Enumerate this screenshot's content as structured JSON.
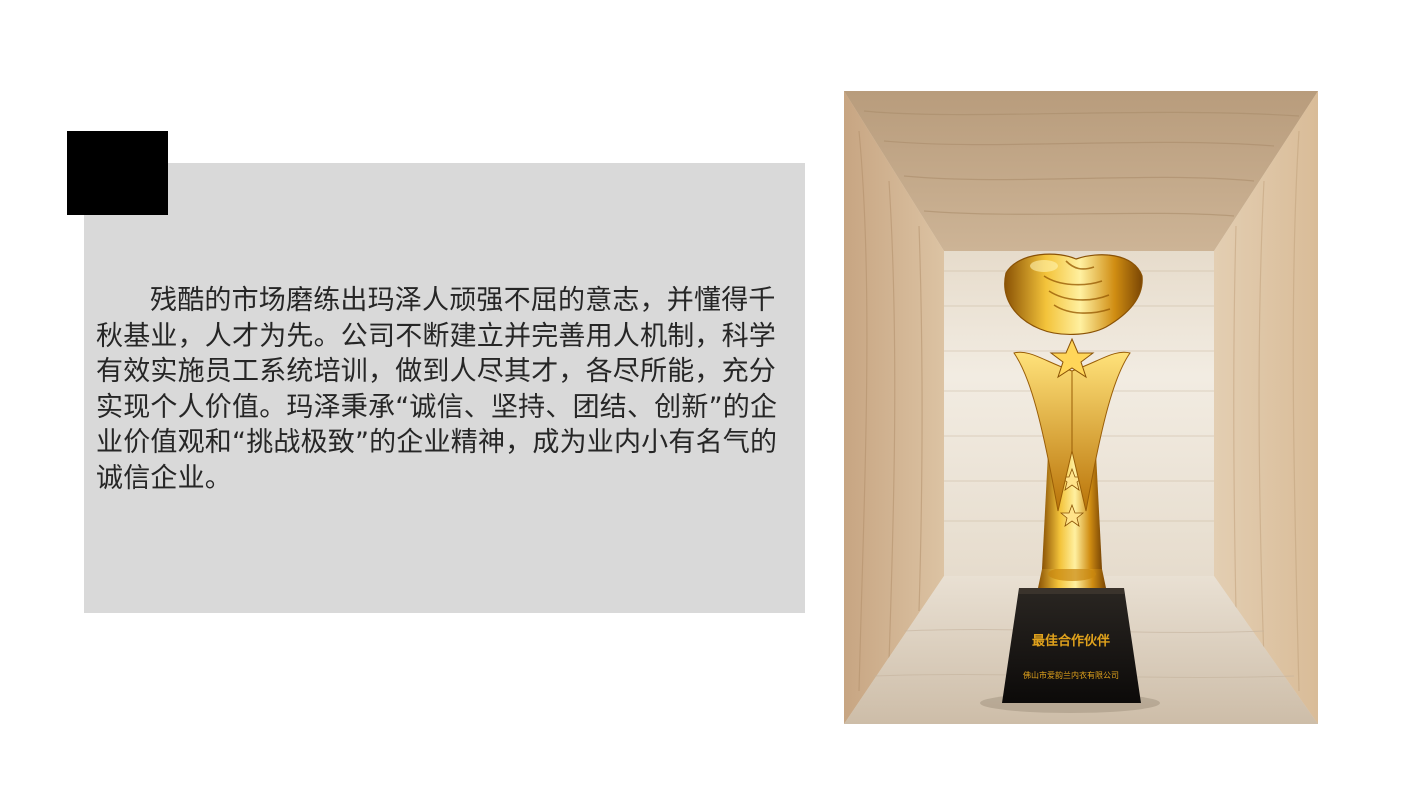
{
  "paragraph": "残酷的市场磨练出玛泽人顽强不屈的意志，并懂得千秋基业，人才为先。公司不断建立并完善用人机制，科学有效实施员工系统培训，做到人尽其才，各尽所能，充分实现个人价值。玛泽秉承“诚信、坚持、团结、创新”的企业价值观和“挑战极致”的企业精神，成为业内小有名气的诚信企业。",
  "trophy": {
    "award_title": "最佳合作伙伴",
    "recipient": "佛山市爱韵兰内衣有限公司"
  },
  "colors": {
    "panel": "#d9d9d9",
    "corner_block": "#000000",
    "text": "#262626",
    "gold": "#e0a21c"
  }
}
